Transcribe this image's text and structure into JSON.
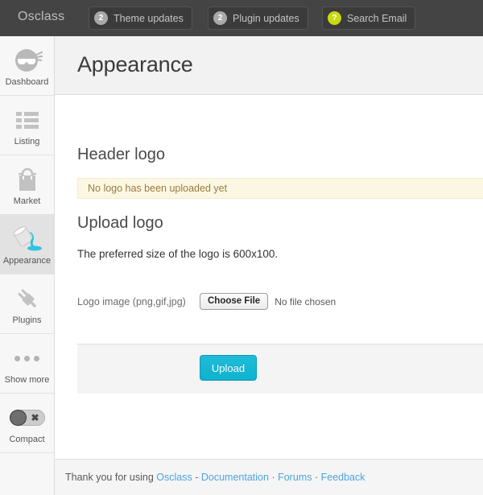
{
  "topbar": {
    "brand": "Osclass",
    "buttons": [
      {
        "badge": "2",
        "badge_style": "gray",
        "label": "Theme updates",
        "icon": "count-badge"
      },
      {
        "badge": "2",
        "badge_style": "gray",
        "label": "Plugin updates",
        "icon": "count-badge"
      },
      {
        "badge": "?",
        "badge_style": "lime",
        "label": "Search Email",
        "icon": "question-badge"
      }
    ]
  },
  "sidebar": {
    "items": [
      {
        "label": "Dashboard",
        "icon": "ninja-icon",
        "active": false
      },
      {
        "label": "Listing",
        "icon": "list-icon",
        "active": false
      },
      {
        "label": "Market",
        "icon": "shopping-bag-icon",
        "active": false
      },
      {
        "label": "Appearance",
        "icon": "paint-bucket-icon",
        "active": true
      },
      {
        "label": "Plugins",
        "icon": "plug-icon",
        "active": false
      },
      {
        "label": "Show more",
        "icon": "ellipsis-icon",
        "active": false
      },
      {
        "label": "Compact",
        "icon": "toggle-off-icon",
        "active": false
      }
    ]
  },
  "page": {
    "title": "Appearance",
    "header_logo_heading": "Header logo",
    "alert_text": "No logo has been uploaded yet",
    "upload_logo_heading": "Upload logo",
    "help_text": "The preferred size of the logo is 600x100.",
    "file_label": "Logo image (png,gif,jpg)",
    "choose_file_label": "Choose File",
    "file_status": "No file chosen",
    "upload_button_label": "Upload"
  },
  "footer": {
    "thanks": "Thank you for using",
    "brand_link": "Osclass",
    "dash": "-",
    "links": [
      {
        "label": "Documentation"
      },
      {
        "label": "Forums"
      },
      {
        "label": "Feedback"
      }
    ],
    "separator": "·"
  },
  "colors": {
    "topbar_bg": "#444444",
    "accent": "#0fb2cf",
    "badge_lime": "#c8d911",
    "alert_bg": "#fcf7e3",
    "alert_text": "#9a7b41",
    "link": "#4ea3e0"
  }
}
